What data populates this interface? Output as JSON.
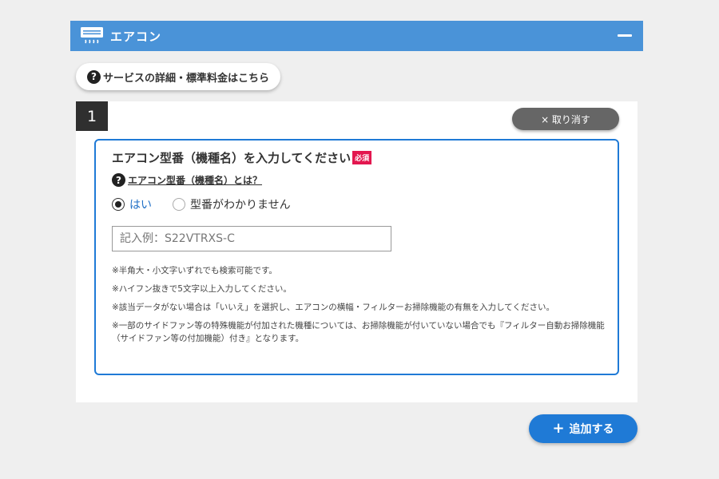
{
  "section": {
    "title": "エアコン",
    "icon": "air-conditioner-icon",
    "collapse_icon": "minus-icon"
  },
  "info_link": {
    "icon_text": "?",
    "label": "サービスの詳細・標準料金はこちら"
  },
  "item": {
    "number": "1",
    "cancel_label": "× 取り消す",
    "form": {
      "title": "エアコン型番（機種名）を入力してください",
      "required_badge": "必須",
      "help_icon_text": "?",
      "help_link": "エアコン型番（機種名）とは？",
      "radio_options": [
        {
          "label": "はい",
          "checked": true
        },
        {
          "label": "型番がわかりません",
          "checked": false
        }
      ],
      "input": {
        "value": "",
        "placeholder": "記入例：S22VTRXS-C"
      },
      "notes": [
        "※半角大・小文字いずれでも検索可能です。",
        "※ハイフン抜きで5文字以上入力してください。",
        "※該当データがない場合は「いいえ」を選択し、エアコンの横幅・フィルターお掃除機能の有無を入力してください。",
        "※一部のサイドファン等の特殊機能が付加された機種については、お掃除機能が付いていない場合でも『フィルター自動お掃除機能（サイドファン等の付加機能）付き』となります。"
      ]
    }
  },
  "add_button": {
    "icon": "+",
    "label": "追加する"
  },
  "colors": {
    "header": "#4a93d8",
    "accent": "#1f7ad6",
    "required": "#e3174f",
    "background": "#efefef"
  }
}
